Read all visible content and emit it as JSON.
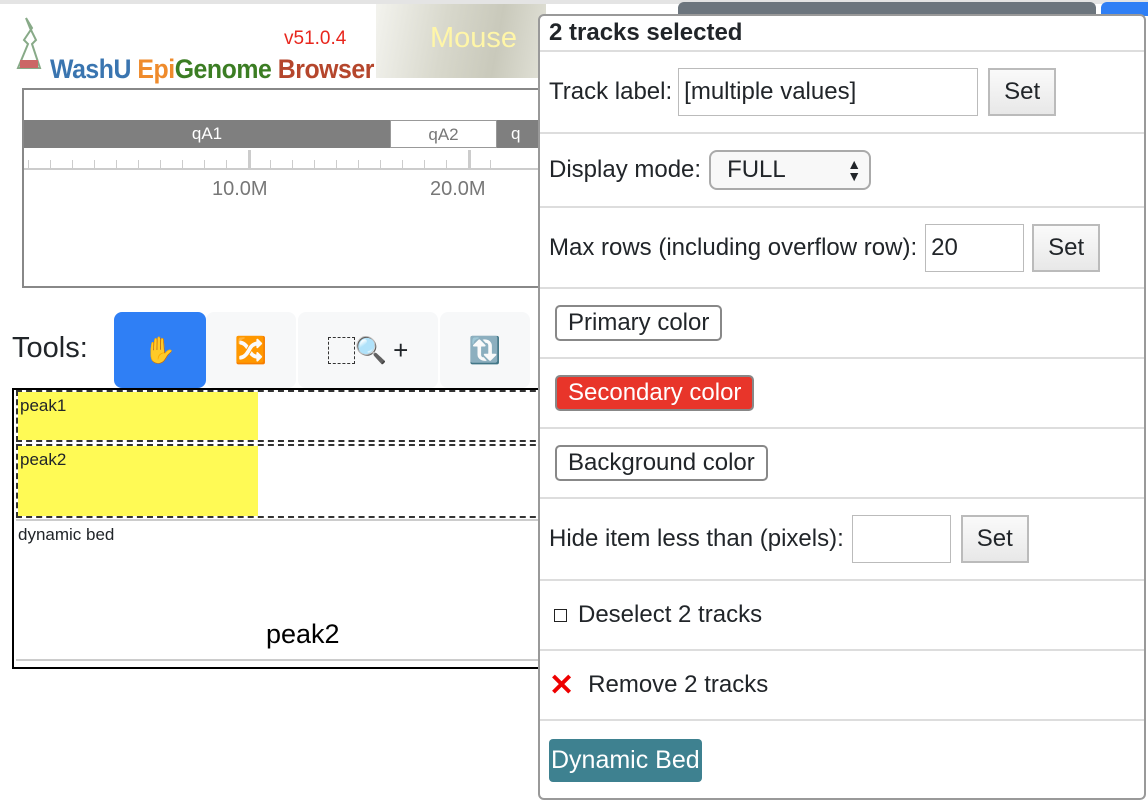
{
  "header": {
    "version": "v51.0.4",
    "brand": {
      "washu": "WashU ",
      "epi": "Epi",
      "genome": "Genome ",
      "browser": "Browser"
    },
    "genome": "Mouse"
  },
  "ruler": {
    "bands": [
      {
        "label": "qA1",
        "color": "#7f7f7f"
      },
      {
        "label": "qA2",
        "color": "#ffffff"
      },
      {
        "label": "q",
        "color": "#7f7f7f"
      }
    ],
    "tick_labels": [
      "10.0M",
      "20.0M"
    ]
  },
  "tools": {
    "label": "Tools:",
    "items": [
      {
        "name": "drag",
        "icon": "✋",
        "active": true
      },
      {
        "name": "reorder",
        "icon": "🔀"
      },
      {
        "name": "zoom-in",
        "icon": "🔍",
        "extra": "+"
      },
      {
        "name": "rotate",
        "icon": "🔃"
      }
    ]
  },
  "tracks": [
    {
      "name": "peak1",
      "selected": true
    },
    {
      "name": "peak2",
      "selected": true
    },
    {
      "name": "dynamic bed",
      "feature_label": "peak2"
    }
  ],
  "popup": {
    "title": "2 tracks selected",
    "track_label": {
      "label": "Track label:",
      "value": "[multiple values]",
      "button": "Set"
    },
    "display_mode": {
      "label": "Display mode:",
      "value": "FULL"
    },
    "max_rows": {
      "label": "Max rows (including overflow row):",
      "value": "20",
      "button": "Set"
    },
    "primary_color": {
      "label": "Primary color",
      "color": "#ffffff"
    },
    "secondary_color": {
      "label": "Secondary color",
      "color": "#e8352a"
    },
    "background_color": {
      "label": "Background color",
      "color": "#ffffff"
    },
    "hide_item": {
      "label": "Hide item less than (pixels):",
      "value": "",
      "button": "Set"
    },
    "deselect": {
      "label": "Deselect 2 tracks"
    },
    "remove": {
      "label": "Remove 2 tracks"
    },
    "dynamic_bed": {
      "label": "Dynamic Bed",
      "color": "#3e8190"
    }
  }
}
